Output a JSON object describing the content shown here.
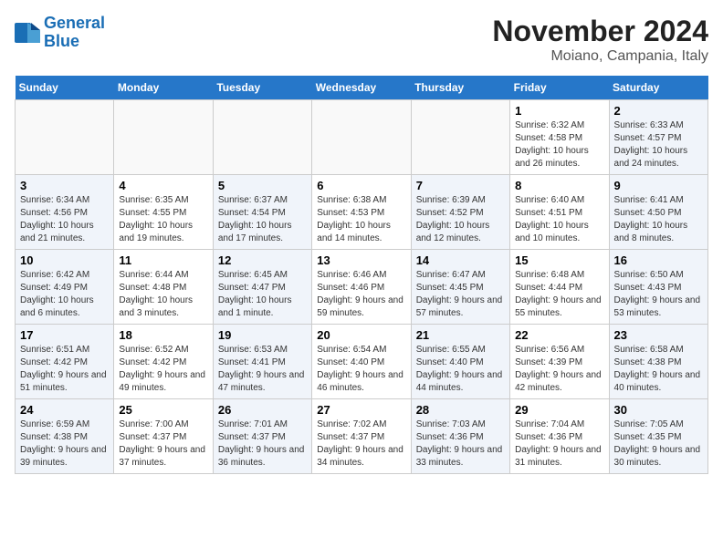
{
  "header": {
    "logo_line1": "General",
    "logo_line2": "Blue",
    "month_year": "November 2024",
    "location": "Moiano, Campania, Italy"
  },
  "weekdays": [
    "Sunday",
    "Monday",
    "Tuesday",
    "Wednesday",
    "Thursday",
    "Friday",
    "Saturday"
  ],
  "weeks": [
    [
      {
        "day": "",
        "info": ""
      },
      {
        "day": "",
        "info": ""
      },
      {
        "day": "",
        "info": ""
      },
      {
        "day": "",
        "info": ""
      },
      {
        "day": "",
        "info": ""
      },
      {
        "day": "1",
        "info": "Sunrise: 6:32 AM\nSunset: 4:58 PM\nDaylight: 10 hours and 26 minutes."
      },
      {
        "day": "2",
        "info": "Sunrise: 6:33 AM\nSunset: 4:57 PM\nDaylight: 10 hours and 24 minutes."
      }
    ],
    [
      {
        "day": "3",
        "info": "Sunrise: 6:34 AM\nSunset: 4:56 PM\nDaylight: 10 hours and 21 minutes."
      },
      {
        "day": "4",
        "info": "Sunrise: 6:35 AM\nSunset: 4:55 PM\nDaylight: 10 hours and 19 minutes."
      },
      {
        "day": "5",
        "info": "Sunrise: 6:37 AM\nSunset: 4:54 PM\nDaylight: 10 hours and 17 minutes."
      },
      {
        "day": "6",
        "info": "Sunrise: 6:38 AM\nSunset: 4:53 PM\nDaylight: 10 hours and 14 minutes."
      },
      {
        "day": "7",
        "info": "Sunrise: 6:39 AM\nSunset: 4:52 PM\nDaylight: 10 hours and 12 minutes."
      },
      {
        "day": "8",
        "info": "Sunrise: 6:40 AM\nSunset: 4:51 PM\nDaylight: 10 hours and 10 minutes."
      },
      {
        "day": "9",
        "info": "Sunrise: 6:41 AM\nSunset: 4:50 PM\nDaylight: 10 hours and 8 minutes."
      }
    ],
    [
      {
        "day": "10",
        "info": "Sunrise: 6:42 AM\nSunset: 4:49 PM\nDaylight: 10 hours and 6 minutes."
      },
      {
        "day": "11",
        "info": "Sunrise: 6:44 AM\nSunset: 4:48 PM\nDaylight: 10 hours and 3 minutes."
      },
      {
        "day": "12",
        "info": "Sunrise: 6:45 AM\nSunset: 4:47 PM\nDaylight: 10 hours and 1 minute."
      },
      {
        "day": "13",
        "info": "Sunrise: 6:46 AM\nSunset: 4:46 PM\nDaylight: 9 hours and 59 minutes."
      },
      {
        "day": "14",
        "info": "Sunrise: 6:47 AM\nSunset: 4:45 PM\nDaylight: 9 hours and 57 minutes."
      },
      {
        "day": "15",
        "info": "Sunrise: 6:48 AM\nSunset: 4:44 PM\nDaylight: 9 hours and 55 minutes."
      },
      {
        "day": "16",
        "info": "Sunrise: 6:50 AM\nSunset: 4:43 PM\nDaylight: 9 hours and 53 minutes."
      }
    ],
    [
      {
        "day": "17",
        "info": "Sunrise: 6:51 AM\nSunset: 4:42 PM\nDaylight: 9 hours and 51 minutes."
      },
      {
        "day": "18",
        "info": "Sunrise: 6:52 AM\nSunset: 4:42 PM\nDaylight: 9 hours and 49 minutes."
      },
      {
        "day": "19",
        "info": "Sunrise: 6:53 AM\nSunset: 4:41 PM\nDaylight: 9 hours and 47 minutes."
      },
      {
        "day": "20",
        "info": "Sunrise: 6:54 AM\nSunset: 4:40 PM\nDaylight: 9 hours and 46 minutes."
      },
      {
        "day": "21",
        "info": "Sunrise: 6:55 AM\nSunset: 4:40 PM\nDaylight: 9 hours and 44 minutes."
      },
      {
        "day": "22",
        "info": "Sunrise: 6:56 AM\nSunset: 4:39 PM\nDaylight: 9 hours and 42 minutes."
      },
      {
        "day": "23",
        "info": "Sunrise: 6:58 AM\nSunset: 4:38 PM\nDaylight: 9 hours and 40 minutes."
      }
    ],
    [
      {
        "day": "24",
        "info": "Sunrise: 6:59 AM\nSunset: 4:38 PM\nDaylight: 9 hours and 39 minutes."
      },
      {
        "day": "25",
        "info": "Sunrise: 7:00 AM\nSunset: 4:37 PM\nDaylight: 9 hours and 37 minutes."
      },
      {
        "day": "26",
        "info": "Sunrise: 7:01 AM\nSunset: 4:37 PM\nDaylight: 9 hours and 36 minutes."
      },
      {
        "day": "27",
        "info": "Sunrise: 7:02 AM\nSunset: 4:37 PM\nDaylight: 9 hours and 34 minutes."
      },
      {
        "day": "28",
        "info": "Sunrise: 7:03 AM\nSunset: 4:36 PM\nDaylight: 9 hours and 33 minutes."
      },
      {
        "day": "29",
        "info": "Sunrise: 7:04 AM\nSunset: 4:36 PM\nDaylight: 9 hours and 31 minutes."
      },
      {
        "day": "30",
        "info": "Sunrise: 7:05 AM\nSunset: 4:35 PM\nDaylight: 9 hours and 30 minutes."
      }
    ]
  ]
}
